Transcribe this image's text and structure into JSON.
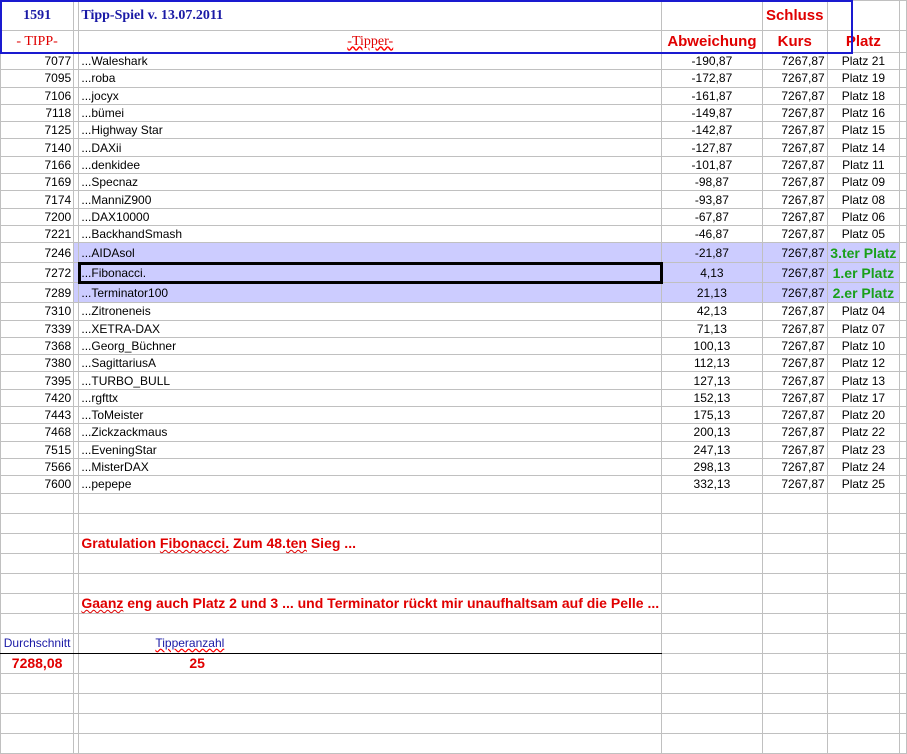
{
  "header": {
    "tipp_count": "1591",
    "title": "Tipp-Spiel v. 13.07.2011",
    "schluss": "Schluss",
    "col_tipp": "- TIPP-",
    "col_tipper": "-Tipper-",
    "col_abweichung": "Abweichung",
    "col_kurs": "Kurs",
    "col_platz": "Platz"
  },
  "rows": [
    [
      "7077",
      "...Waleshark",
      "-190,87",
      "7267,87",
      "Platz 21"
    ],
    [
      "7095",
      "...roba",
      "-172,87",
      "7267,87",
      "Platz 19"
    ],
    [
      "7106",
      "...jocyx",
      "-161,87",
      "7267,87",
      "Platz 18"
    ],
    [
      "7118",
      "...bümei",
      "-149,87",
      "7267,87",
      "Platz 16"
    ],
    [
      "7125",
      "...Highway Star",
      "-142,87",
      "7267,87",
      "Platz 15"
    ],
    [
      "7140",
      "...DAXii",
      "-127,87",
      "7267,87",
      "Platz 14"
    ],
    [
      "7166",
      "...denkidee",
      "-101,87",
      "7267,87",
      "Platz 11"
    ],
    [
      "7169",
      "...Specnaz",
      "-98,87",
      "7267,87",
      "Platz 09"
    ],
    [
      "7174",
      "...ManniZ900",
      "-93,87",
      "7267,87",
      "Platz 08"
    ],
    [
      "7200",
      "...DAX10000",
      "-67,87",
      "7267,87",
      "Platz 06"
    ],
    [
      "7221",
      "...BackhandSmash",
      "-46,87",
      "7267,87",
      "Platz 05"
    ],
    [
      "7246",
      "...AIDAsol",
      "-21,87",
      "7267,87",
      "3.ter Platz"
    ],
    [
      "7272",
      "...Fibonacci.",
      "4,13",
      "7267,87",
      "1.er Platz"
    ],
    [
      "7289",
      "...Terminator100",
      "21,13",
      "7267,87",
      "2.er Platz"
    ],
    [
      "7310",
      "...Zitroneneis",
      "42,13",
      "7267,87",
      "Platz 04"
    ],
    [
      "7339",
      "...XETRA-DAX",
      "71,13",
      "7267,87",
      "Platz 07"
    ],
    [
      "7368",
      "...Georg_Büchner",
      "100,13",
      "7267,87",
      "Platz 10"
    ],
    [
      "7380",
      "...SagittariusA",
      "112,13",
      "7267,87",
      "Platz 12"
    ],
    [
      "7395",
      "...TURBO_BULL",
      "127,13",
      "7267,87",
      "Platz 13"
    ],
    [
      "7420",
      "...rgfttx",
      "152,13",
      "7267,87",
      "Platz 17"
    ],
    [
      "7443",
      "...ToMeister",
      "175,13",
      "7267,87",
      "Platz 20"
    ],
    [
      "7468",
      "...Zickzackmaus",
      "200,13",
      "7267,87",
      "Platz 22"
    ],
    [
      "7515",
      "...EveningStar",
      "247,13",
      "7267,87",
      "Platz 23"
    ],
    [
      "7566",
      "...MisterDAX",
      "298,13",
      "7267,87",
      "Platz 24"
    ],
    [
      "7600",
      "...pepepe",
      "332,13",
      "7267,87",
      "Platz 25"
    ]
  ],
  "highlight_rows": [
    11,
    12,
    13
  ],
  "selected_row": 12,
  "messages": {
    "line1_a": "Gratulation ",
    "line1_b": "Fibonacci.",
    "line1_c": "  Zum  48.",
    "line1_d": "ten",
    "line1_e": " Sieg ...",
    "line2_a": "Gaanz",
    "line2_b": " eng auch Platz 2 und 3 ...  und Terminator rückt mir unaufhaltsam auf die Pelle ..."
  },
  "summary": {
    "durchschnitt_label": "Durchschnitt",
    "tipperanzahl_label": "Tipperanzahl",
    "durchschnitt": "7288,08",
    "tipperanzahl": "25"
  },
  "colors": {
    "highlight": "#ccccff",
    "red": "#e00000",
    "blue": "#1a1aa6",
    "green": "#1aa01a"
  }
}
